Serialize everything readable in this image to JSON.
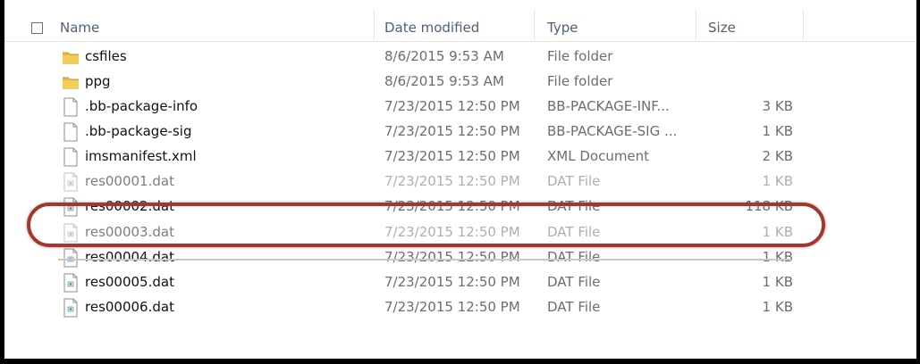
{
  "columns": {
    "name": "Name",
    "date_modified": "Date modified",
    "type": "Type",
    "size": "Size"
  },
  "files": [
    {
      "name": "csfiles",
      "date": "8/6/2015 9:53 AM",
      "type": "File folder",
      "size": "",
      "icon": "folder-icon"
    },
    {
      "name": "ppg",
      "date": "8/6/2015 9:53 AM",
      "type": "File folder",
      "size": "",
      "icon": "folder-icon"
    },
    {
      "name": ".bb-package-info",
      "date": "7/23/2015 12:50 PM",
      "type": "BB-PACKAGE-INF...",
      "size": "3 KB",
      "icon": "file-icon"
    },
    {
      "name": ".bb-package-sig",
      "date": "7/23/2015 12:50 PM",
      "type": "BB-PACKAGE-SIG ...",
      "size": "1 KB",
      "icon": "file-icon"
    },
    {
      "name": "imsmanifest.xml",
      "date": "7/23/2015 12:50 PM",
      "type": "XML Document",
      "size": "2 KB",
      "icon": "file-icon"
    },
    {
      "name": "res00001.dat",
      "date": "7/23/2015 12:50 PM",
      "type": "DAT File",
      "size": "1 KB",
      "icon": "dat-file-icon"
    },
    {
      "name": "res00002.dat",
      "date": "7/23/2015 12:50 PM",
      "type": "DAT File",
      "size": "118 KB",
      "icon": "dat-file-icon",
      "highlighted": true
    },
    {
      "name": "res00003.dat",
      "date": "7/23/2015 12:50 PM",
      "type": "DAT File",
      "size": "1 KB",
      "icon": "dat-file-icon"
    },
    {
      "name": "res00004.dat",
      "date": "7/23/2015 12:50 PM",
      "type": "DAT File",
      "size": "1 KB",
      "icon": "dat-file-icon"
    },
    {
      "name": "res00005.dat",
      "date": "7/23/2015 12:50 PM",
      "type": "DAT File",
      "size": "1 KB",
      "icon": "dat-file-icon"
    },
    {
      "name": "res00006.dat",
      "date": "7/23/2015 12:50 PM",
      "type": "DAT File",
      "size": "1 KB",
      "icon": "dat-file-icon"
    }
  ],
  "colors": {
    "highlight_ring": "#a6362b",
    "header_text": "#4c607a",
    "folder": "#e8b83a"
  }
}
